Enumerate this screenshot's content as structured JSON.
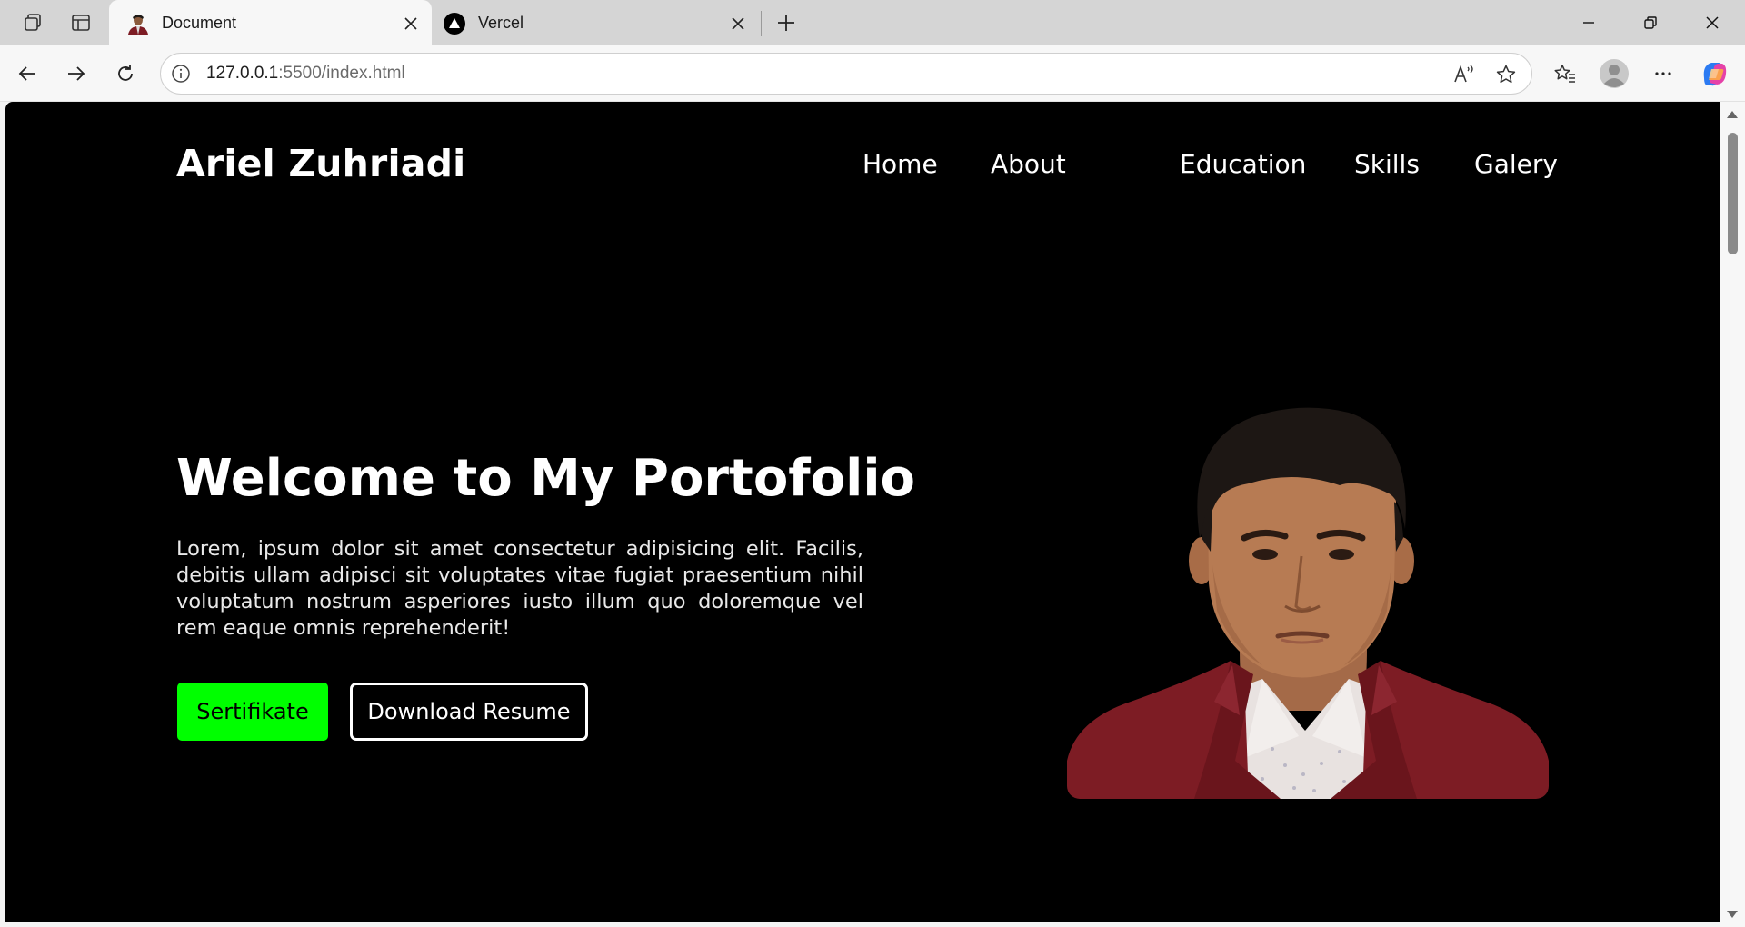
{
  "tabs": [
    {
      "title": "Document",
      "active": true
    },
    {
      "title": "Vercel",
      "active": false
    }
  ],
  "address": {
    "host": "127.0.0.1",
    "path": ":5500/index.html"
  },
  "site": {
    "logo": "Ariel Zuhriadi",
    "nav": [
      "Home",
      "About",
      "Education",
      "Skills",
      "Galery"
    ]
  },
  "hero": {
    "title": "Welcome to My Portofolio",
    "description": "Lorem, ipsum dolor sit amet consectetur adipisicing elit. Facilis, debitis ullam adipisci sit voluptates vitae fugiat praesentium nihil voluptatum nostrum asperiores iusto illum quo doloremque vel rem eaque omnis reprehenderit!",
    "btn_primary": "Sertifikate",
    "btn_secondary": "Download Resume"
  },
  "colors": {
    "accent": "#00ff00",
    "page_bg": "#000000",
    "jacket": "#7d1c24"
  },
  "icons": [
    "workspaces-icon",
    "tab-actions-icon",
    "close-icon",
    "new-tab-icon",
    "minimize-icon",
    "restore-icon",
    "back-icon",
    "forward-icon",
    "refresh-icon",
    "info-icon",
    "read-aloud-icon",
    "star-icon",
    "favorites-icon",
    "profile-icon",
    "more-icon",
    "copilot-icon"
  ]
}
